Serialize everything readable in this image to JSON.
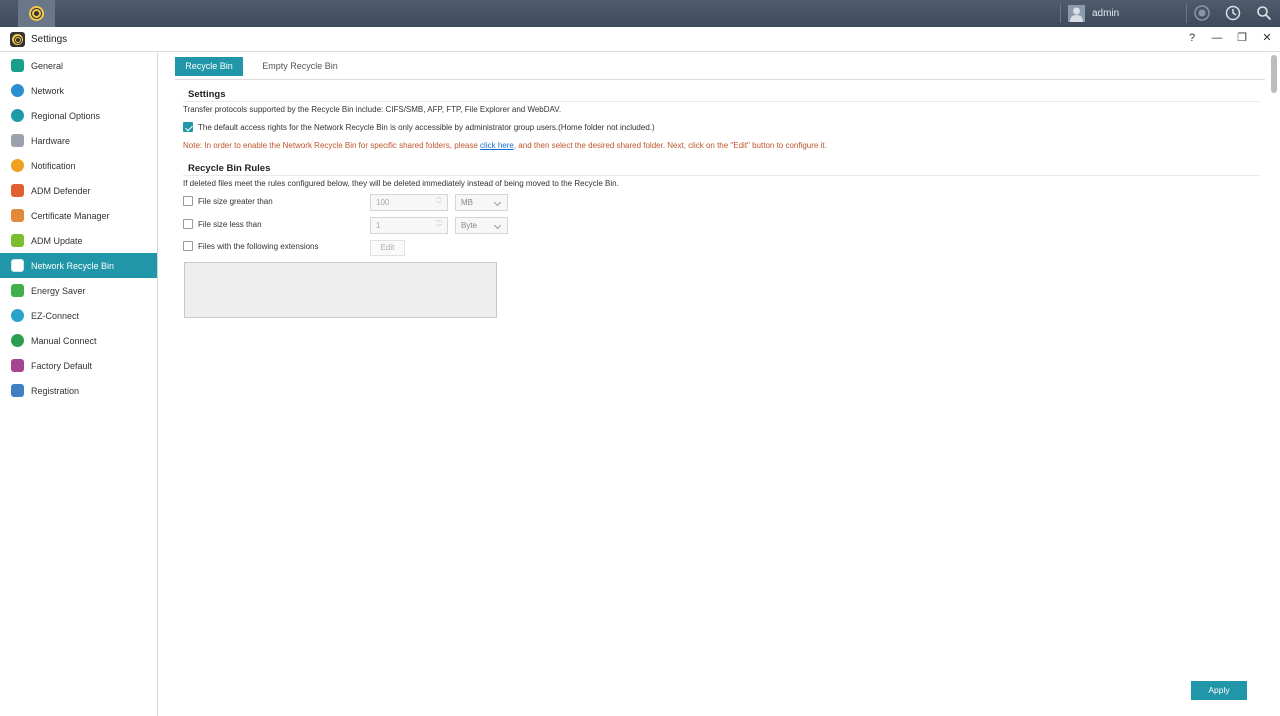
{
  "taskbar": {
    "user_name": "admin"
  },
  "window": {
    "title": "Settings",
    "help_label": "?",
    "minimize_label": "—",
    "restore_label": "❐",
    "close_label": "✕"
  },
  "sidebar": {
    "items": [
      {
        "label": "General",
        "icon": "general-icon",
        "color": "#1aa08a"
      },
      {
        "label": "Network",
        "icon": "globe-icon",
        "color": "#2a8fcf"
      },
      {
        "label": "Regional Options",
        "icon": "region-icon",
        "color": "#1f9aa8"
      },
      {
        "label": "Hardware",
        "icon": "hardware-icon",
        "color": "#8c8c8c"
      },
      {
        "label": "Notification",
        "icon": "notification-icon",
        "color": "#f0a020"
      },
      {
        "label": "ADM Defender",
        "icon": "firewall-icon",
        "color": "#e06030"
      },
      {
        "label": "Certificate Manager",
        "icon": "certificate-icon",
        "color": "#e08a3a"
      },
      {
        "label": "ADM Update",
        "icon": "update-arrow-icon",
        "color": "#7cbf2e"
      },
      {
        "label": "Network Recycle Bin",
        "icon": "recycle-bin-icon",
        "color": "#ffffff"
      },
      {
        "label": "Energy Saver",
        "icon": "energy-icon",
        "color": "#42b04a"
      },
      {
        "label": "EZ-Connect",
        "icon": "cloud-icon",
        "color": "#2aa3c9"
      },
      {
        "label": "Manual Connect",
        "icon": "manual-connect-icon",
        "color": "#2c9c4f"
      },
      {
        "label": "Factory Default",
        "icon": "undo-icon",
        "color": "#a3458f"
      },
      {
        "label": "Registration",
        "icon": "registration-icon",
        "color": "#3f7fc2"
      }
    ],
    "active_index": 8
  },
  "tabs": {
    "recycle_bin": "Recycle Bin",
    "empty_recycle_bin": "Empty Recycle Bin"
  },
  "settings": {
    "title": "Settings",
    "protocols_text": "Transfer protocols supported by the Recycle Bin include: CIFS/SMB, AFP, FTP, File Explorer and WebDAV.",
    "access_rights_label": "The default access rights for the Network Recycle Bin is only accessible by administrator group users.(Home folder not included.)",
    "access_rights_checked": true,
    "note_prefix": "Note: In order to enable the Network Recycle Bin for specific shared folders, please ",
    "note_link": "click here",
    "note_suffix": ", and then select the desired shared folder. Next, click on the \"Edit\" button to configure it."
  },
  "rules": {
    "title": "Recycle Bin Rules",
    "description": "If deleted files meet the rules configured below, they will be deleted immediately instead of being moved to the Recycle Bin.",
    "size_greater": {
      "label": "File size greater than",
      "checked": false,
      "value": "100",
      "unit": "MB"
    },
    "size_less": {
      "label": "File size less than",
      "checked": false,
      "value": "1",
      "unit": "Byte"
    },
    "extensions": {
      "label": "Files with the following extensions",
      "checked": false,
      "edit_label": "Edit"
    }
  },
  "footer": {
    "apply_label": "Apply"
  },
  "colors": {
    "accent": "#2196a8",
    "note_text": "#c0552b",
    "link": "#1a6fd1"
  }
}
